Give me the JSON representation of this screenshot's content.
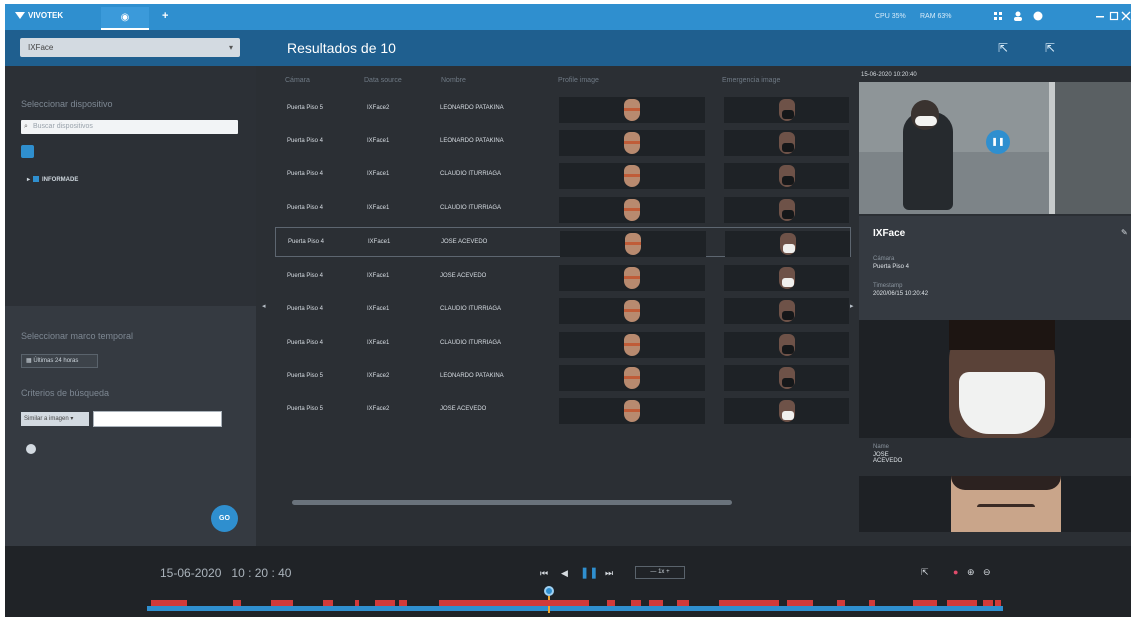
{
  "topbar": {
    "brand": "VIVOTEK",
    "active_tab_icon": "camera-tab-icon",
    "add_tab": "+",
    "stat1": "CPU 35%",
    "stat2": "RAM 63%",
    "accent": "#2f8fcf"
  },
  "subheader": {
    "camera_select": "IXFace",
    "results_title": "Resultados de 10"
  },
  "left": {
    "device_label": "Seleccionar dispositivo",
    "search_placeholder": "Buscar dispositivos",
    "tree_item": "INFORMADE",
    "time_label": "Seleccionar marco temporal",
    "date_button": "Últimas 24 horas",
    "criteria_label": "Criterios de búsqueda",
    "criteria_select": "Similar a imagen",
    "fab": "GO"
  },
  "table": {
    "headers": [
      "Cámara",
      "Data source",
      "Nombre",
      "Profile image",
      "Emergencia image"
    ],
    "rows": [
      {
        "camera": "Puerta Piso 5",
        "source": "IXFace2",
        "name": "LEONARDO PATAKINA",
        "mask": false
      },
      {
        "camera": "Puerta Piso 4",
        "source": "IXFace1",
        "name": "LEONARDO PATAKINA",
        "mask": false
      },
      {
        "camera": "Puerta Piso 4",
        "source": "IXFace1",
        "name": "CLAUDIO ITURRIAGA",
        "mask": false
      },
      {
        "camera": "Puerta Piso 4",
        "source": "IXFace1",
        "name": "CLAUDIO ITURRIAGA",
        "mask": false
      },
      {
        "camera": "Puerta Piso 4",
        "source": "IXFace1",
        "name": "JOSE ACEVEDO",
        "mask": true
      },
      {
        "camera": "Puerta Piso 4",
        "source": "IXFace1",
        "name": "JOSE ACEVEDO",
        "mask": true
      },
      {
        "camera": "Puerta Piso 4",
        "source": "IXFace1",
        "name": "CLAUDIO ITURRIAGA",
        "mask": false
      },
      {
        "camera": "Puerta Piso 4",
        "source": "IXFace1",
        "name": "CLAUDIO ITURRIAGA",
        "mask": false
      },
      {
        "camera": "Puerta Piso 5",
        "source": "IXFace2",
        "name": "LEONARDO PATAKINA",
        "mask": false
      },
      {
        "camera": "Puerta Piso 5",
        "source": "IXFace2",
        "name": "JOSE ACEVEDO",
        "mask": true
      }
    ]
  },
  "detail": {
    "timestamp": "15-06-2020 10:20:40",
    "title": "IXFace",
    "camera_label": "Cámara",
    "camera_value": "Puerta Piso 4",
    "time_label": "Timestamp",
    "time_value": "2020/06/15 10:20:42",
    "name_label": "Name",
    "name_value": "JOSE ACEVEDO"
  },
  "playback": {
    "date": "15-06-2020",
    "time": "10 : 20 : 40",
    "speed": "— 1x +"
  }
}
